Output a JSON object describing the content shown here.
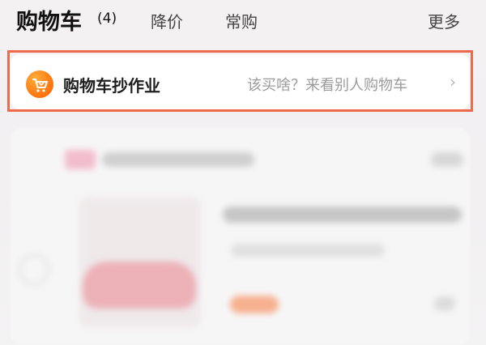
{
  "header": {
    "title": "购物车",
    "count": "(4)",
    "tabs": [
      {
        "label": "降价"
      },
      {
        "label": "常购"
      }
    ],
    "more": "更多"
  },
  "banner": {
    "title": "购物车抄作业",
    "subtitle": "该买啥？来看别人购物车",
    "chevron": "›",
    "icon": "shopping-cart-icon",
    "accent": "#ff7a12",
    "highlight_color": "#ef6a4b"
  }
}
